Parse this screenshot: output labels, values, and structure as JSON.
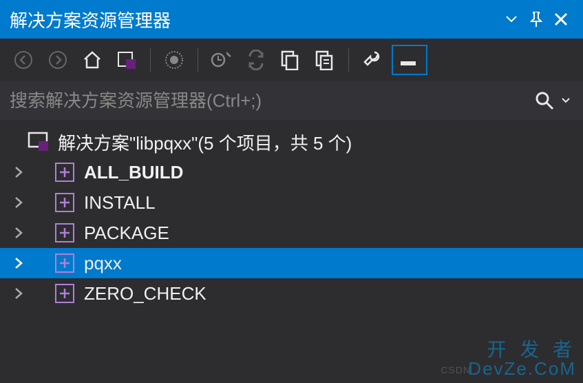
{
  "titlebar": {
    "title": "解决方案资源管理器"
  },
  "search": {
    "placeholder": "搜索解决方案资源管理器(Ctrl+;)"
  },
  "solution": {
    "label": "解决方案\"libpqxx\"(5 个项目，共 5 个)"
  },
  "projects": [
    {
      "name": "ALL_BUILD",
      "bold": true,
      "selected": false
    },
    {
      "name": "INSTALL",
      "bold": false,
      "selected": false
    },
    {
      "name": "PACKAGE",
      "bold": false,
      "selected": false
    },
    {
      "name": "pqxx",
      "bold": false,
      "selected": true
    },
    {
      "name": "ZERO_CHECK",
      "bold": false,
      "selected": false
    }
  ],
  "watermark": {
    "line1": "开 发 者",
    "line2": "DevZe.CoM",
    "csdn": "CSDN"
  }
}
